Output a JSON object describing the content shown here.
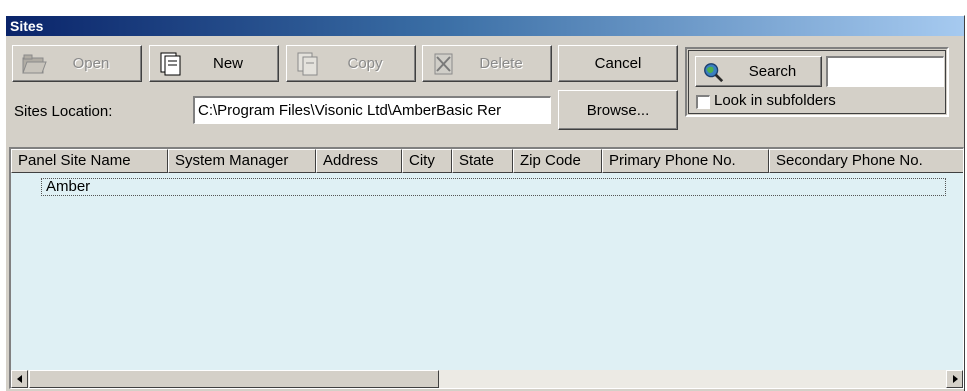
{
  "window": {
    "title": "Sites"
  },
  "toolbar": {
    "open_label": "Open",
    "new_label": "New",
    "copy_label": "Copy",
    "delete_label": "Delete",
    "cancel_label": "Cancel",
    "browse_label": "Browse..."
  },
  "search": {
    "button_label": "Search",
    "value": "",
    "subfolders_label": "Look in subfolders",
    "subfolders_checked": false
  },
  "location": {
    "label": "Sites Location:",
    "value": "C:\\Program Files\\Visonic Ltd\\AmberBasic Rer"
  },
  "table": {
    "columns": [
      "Panel Site Name",
      "System Manager",
      "Address",
      "City",
      "State",
      "Zip Code",
      "Primary Phone No.",
      "Secondary Phone No."
    ],
    "rows": [
      {
        "name": "Amber"
      }
    ]
  },
  "colors": {
    "list_background": "#dff0f4",
    "title_gradient_start": "#0a246a"
  },
  "icons": {
    "open": "folder-open-icon",
    "new": "new-document-icon",
    "copy": "copy-icon",
    "delete": "delete-icon",
    "search": "magnifier-globe-icon"
  }
}
